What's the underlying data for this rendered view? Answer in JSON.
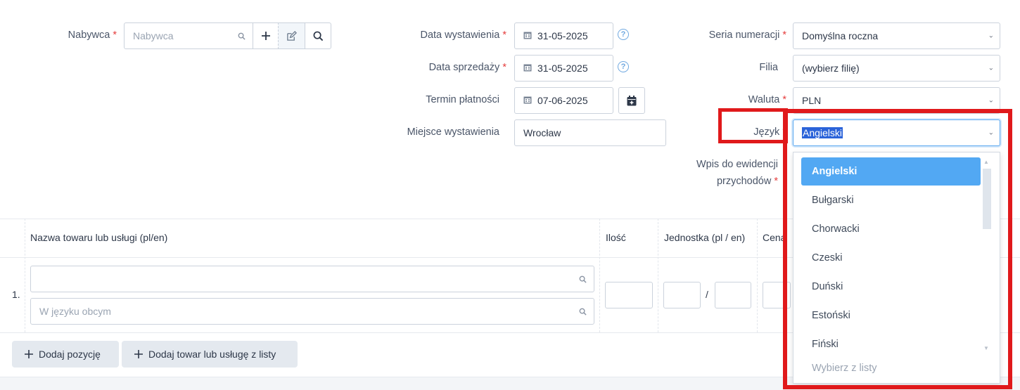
{
  "buyer": {
    "label": "Nabywca",
    "placeholder": "Nabywca"
  },
  "dates": {
    "issue_label": "Data wystawienia",
    "issue_value": "31-05-2025",
    "sale_label": "Data sprzedaży",
    "sale_value": "31-05-2025",
    "due_label": "Termin płatności",
    "due_value": "07-06-2025",
    "place_label": "Miejsce wystawienia",
    "place_value": "Wrocław"
  },
  "right_fields": {
    "series_label": "Seria numeracji",
    "series_value": "Domyślna roczna",
    "branch_label": "Filia",
    "branch_value": "(wybierz filię)",
    "currency_label": "Waluta",
    "currency_value": "PLN",
    "language_label": "Język",
    "language_value": "Angielski",
    "register_label_line1": "Wpis do ewidencji",
    "register_label_line2": "przychodów"
  },
  "required_mark": "*",
  "language_dropdown": {
    "options": [
      "Angielski",
      "Bułgarski",
      "Chorwacki",
      "Czeski",
      "Duński",
      "Estoński",
      "Fiński"
    ],
    "selected": "Angielski",
    "footer": "Wybierz z listy"
  },
  "table": {
    "headers": {
      "name": "Nazwa towaru lub usługi (pl/en)",
      "qty": "Ilość",
      "unit": "Jednostka (pl / en)",
      "price": "Cena"
    },
    "row_number": "1.",
    "foreign_placeholder": "W języku obcym",
    "unit_separator": "/"
  },
  "actions": {
    "add_position": "Dodaj pozycję",
    "add_from_list": "Dodaj towar lub usługę z listy"
  },
  "colors": {
    "accent": "#52a8f3",
    "required": "#e53e3e",
    "highlight": "#e0191b"
  }
}
